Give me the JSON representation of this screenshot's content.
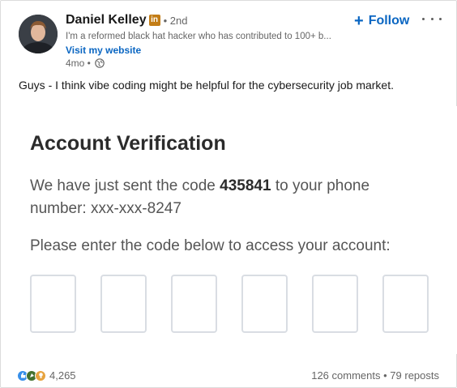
{
  "author": {
    "name": "Daniel Kelley",
    "badge": "in",
    "degree": "• 2nd",
    "headline": "I'm a reformed black hat hacker who has contributed to 100+ b...",
    "website_link": "Visit my website",
    "time": "4mo •"
  },
  "actions": {
    "follow_plus": "+",
    "follow_label": "Follow"
  },
  "post": {
    "text": "Guys - I think vibe coding might be helpful for the cybersecurity job market."
  },
  "image": {
    "title": "Account Verification",
    "line1_prefix": "We have just sent the code",
    "line1_code": "435841",
    "line1_suffix": "to your phone",
    "line2": "number: xxx-xxx-8247",
    "line3": "Please enter the code below to access your account:"
  },
  "footer": {
    "reaction_count": "4,265",
    "comments": "126 comments",
    "separator": "•",
    "reposts": "79 reposts"
  },
  "colors": {
    "accent": "#0a66c2",
    "badge": "#c37d16",
    "like": "#378fe9",
    "celebrate": "#44712e",
    "insight": "#e7a33e"
  },
  "icons": [
    "linkedin-badge-icon",
    "globe-icon",
    "plus-icon",
    "more-dots-icon",
    "like-reaction-icon",
    "celebrate-reaction-icon",
    "insightful-reaction-icon"
  ]
}
